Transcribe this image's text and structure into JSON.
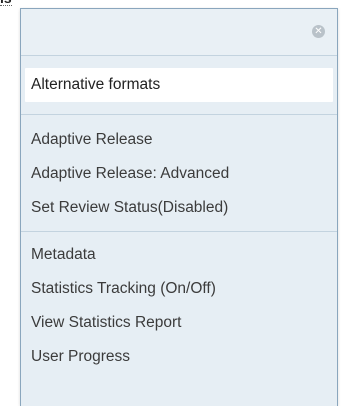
{
  "trigger": {
    "label": "ls"
  },
  "menu": {
    "close_icon": "✕",
    "active_item": "Alternative formats",
    "group1": [
      "Adaptive Release",
      "Adaptive Release: Advanced",
      "Set Review Status(Disabled)"
    ],
    "group2": [
      "Metadata",
      "Statistics Tracking (On/Off)",
      "View Statistics Report",
      "User Progress"
    ]
  }
}
